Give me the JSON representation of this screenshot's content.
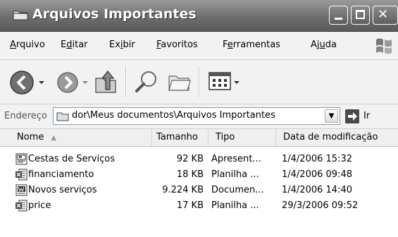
{
  "window": {
    "title": "Arquivos Importantes"
  },
  "menu": [
    {
      "label": "Arquivo",
      "key": "A",
      "rest": "rquivo"
    },
    {
      "label": "Editar",
      "pre": "E",
      "key": "d",
      "rest": "itar"
    },
    {
      "label": "Exibir",
      "pre": "Ex",
      "key": "i",
      "rest": "bir"
    },
    {
      "label": "Favoritos",
      "key": "F",
      "rest": "avoritos"
    },
    {
      "label": "Ferramentas",
      "pre": "F",
      "key": "e",
      "rest": "rramentas"
    },
    {
      "label": "Ajuda",
      "pre": "Aj",
      "key": "u",
      "rest": "da"
    }
  ],
  "address": {
    "label": "Endereço",
    "value": "dor\\Meus documentos\\Arquivos Importantes",
    "go_label": "Ir"
  },
  "columns": [
    "Nome",
    "Tamanho",
    "Tipo",
    "Data de modificação"
  ],
  "files": [
    {
      "name": "Cestas de Serviços",
      "size": "92 KB",
      "type": "Apresent...",
      "modified": "1/4/2006 15:32",
      "icon": "powerpoint-file-icon"
    },
    {
      "name": "financiamento",
      "size": "18 KB",
      "type": "Planilha ...",
      "modified": "1/4/2006 09:48",
      "icon": "excel-file-icon"
    },
    {
      "name": "Novos serviços",
      "size": "9.224 KB",
      "type": "Documen...",
      "modified": "1/4/2006 14:40",
      "icon": "word-file-icon"
    },
    {
      "name": "price",
      "size": "17 KB",
      "type": "Planilha ...",
      "modified": "29/3/2006 09:52",
      "icon": "excel-file-icon"
    }
  ]
}
